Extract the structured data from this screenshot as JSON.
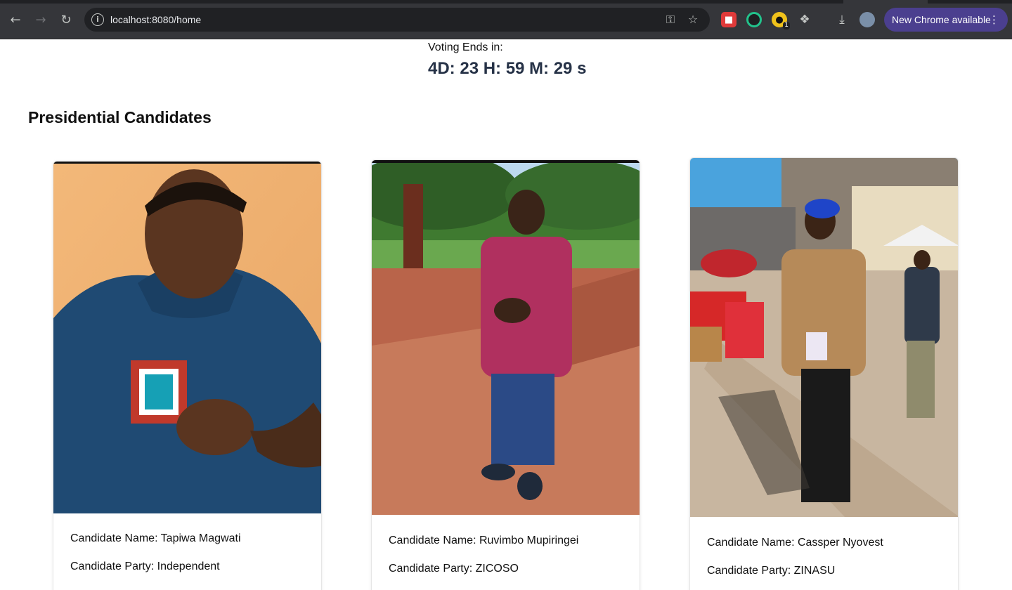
{
  "browser": {
    "url": "localhost:8080/home",
    "update_label": "New Chrome available",
    "extension_badge": "1"
  },
  "countdown": {
    "label": "Voting Ends in:",
    "value": "4D: 23 H: 59 M: 29 s"
  },
  "section_title": "Presidential Candidates",
  "candidates": [
    {
      "name_line": "Candidate Name: Tapiwa Magwati",
      "party_line": "Candidate Party: Independent"
    },
    {
      "name_line": "Candidate Name: Ruvimbo Mupiringei",
      "party_line": "Candidate Party: ZICOSO"
    },
    {
      "name_line": "Candidate Name: Cassper Nyovest",
      "party_line": "Candidate Party: ZINASU"
    }
  ],
  "colors": {
    "countdown_value": "#263247",
    "chrome_bg": "#35363a",
    "update_button": "#4b3f8f"
  }
}
